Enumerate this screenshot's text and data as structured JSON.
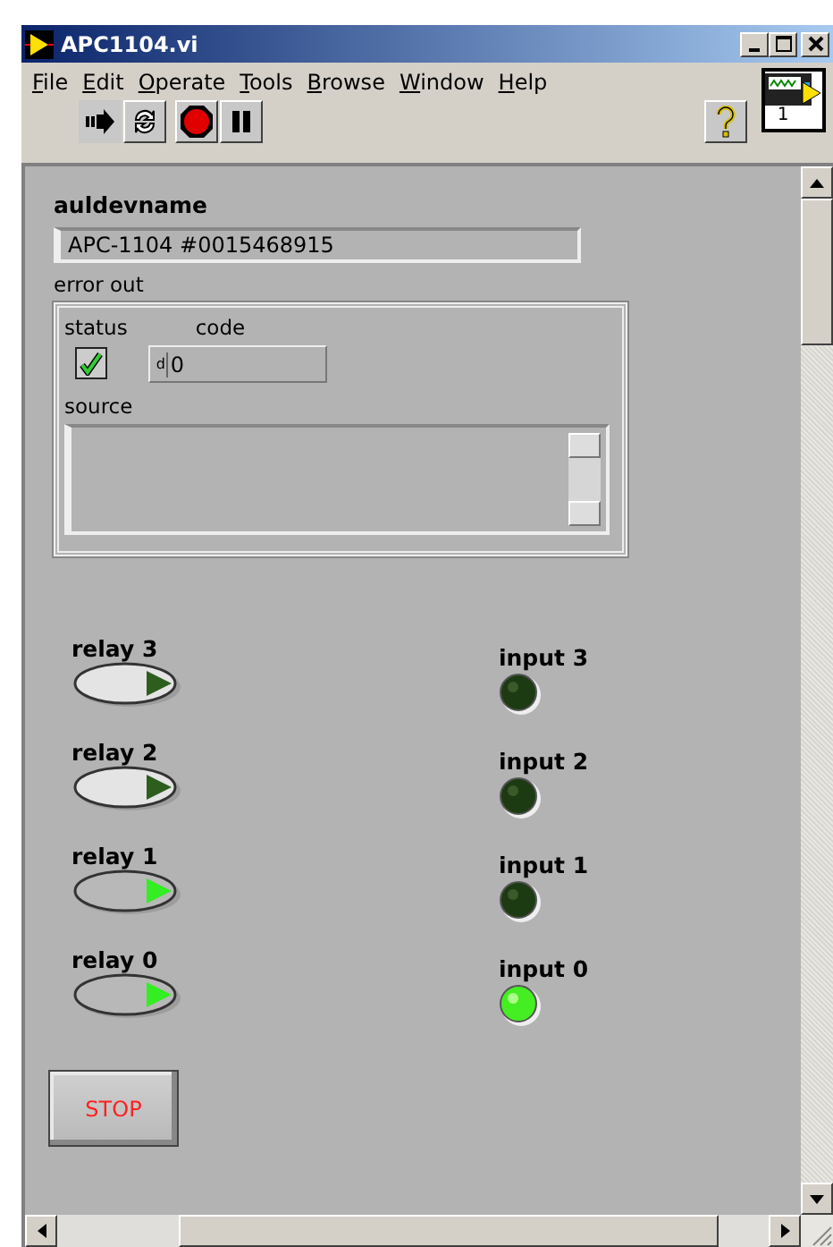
{
  "window": {
    "title": "APC1104.vi"
  },
  "menu": [
    {
      "label": "File"
    },
    {
      "label": "Edit"
    },
    {
      "label": "Operate"
    },
    {
      "label": "Tools"
    },
    {
      "label": "Browse"
    },
    {
      "label": "Window"
    },
    {
      "label": "Help"
    }
  ],
  "connector_pane": {
    "label": "1"
  },
  "auldevname": {
    "label": "auldevname",
    "value": "APC-1104 #0015468915"
  },
  "error_out": {
    "label": "error out",
    "status": {
      "label": "status",
      "checked": true
    },
    "code": {
      "label": "code",
      "radix": "d",
      "value": "0"
    },
    "source": {
      "label": "source"
    }
  },
  "relays": [
    {
      "label": "relay 3",
      "on": false
    },
    {
      "label": "relay 2",
      "on": false
    },
    {
      "label": "relay 1",
      "on": true
    },
    {
      "label": "relay 0",
      "on": true
    }
  ],
  "inputs": [
    {
      "label": "input 3",
      "on": false
    },
    {
      "label": "input 2",
      "on": false
    },
    {
      "label": "input 1",
      "on": false
    },
    {
      "label": "input 0",
      "on": true
    }
  ],
  "stop_button": {
    "label": "STOP"
  }
}
